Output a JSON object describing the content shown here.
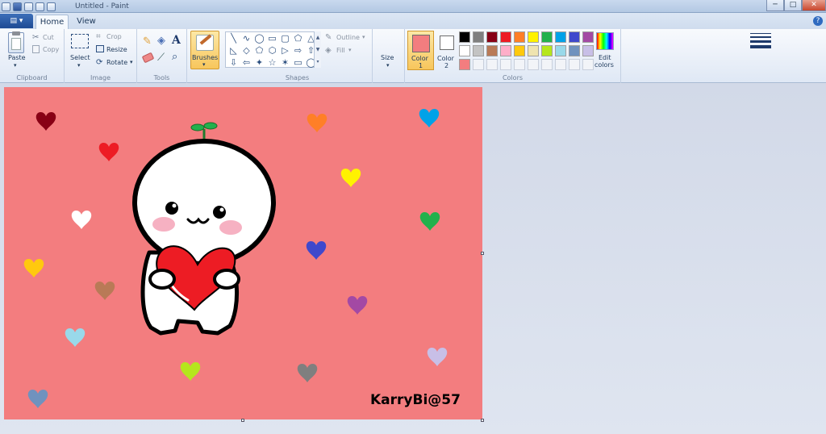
{
  "window": {
    "title": "Untitled - Paint",
    "minimize": "─",
    "maximize": "□",
    "close": "✕"
  },
  "tabs": {
    "app_button": "▤ ▾",
    "home": "Home",
    "view": "View",
    "help": "?"
  },
  "clipboard": {
    "paste": "Paste",
    "cut": "Cut",
    "copy": "Copy",
    "group": "Clipboard"
  },
  "image": {
    "select": "Select",
    "crop": "Crop",
    "resize": "Resize",
    "rotate": "Rotate",
    "group": "Image"
  },
  "tools": {
    "group": "Tools"
  },
  "brushes": {
    "label": "Brushes"
  },
  "shapes": {
    "group": "Shapes",
    "outline": "Outline",
    "fill": "Fill",
    "items": [
      "╲",
      "∿",
      "◯",
      "▭",
      "▢",
      "⬠",
      "△",
      "◺",
      "◇",
      "⬠",
      "⬡",
      "▷",
      "⇨",
      "⇧",
      "⇩",
      "⇦",
      "✦",
      "☆",
      "✶",
      "▭",
      "◯"
    ]
  },
  "size": {
    "label": "Size"
  },
  "colors": {
    "group": "Colors",
    "color1_label": "Color",
    "color1_num": "1",
    "color2_label": "Color",
    "color2_num": "2",
    "edit_label": "Edit",
    "edit_label2": "colors",
    "color1_value": "#f37d7f",
    "color2_value": "#ffffff",
    "palette_row1": [
      "#000000",
      "#7f7f7f",
      "#880015",
      "#ed1c24",
      "#ff7f27",
      "#fff200",
      "#22b14c",
      "#00a2e8",
      "#3f48cc",
      "#a349a4"
    ],
    "palette_row2": [
      "#ffffff",
      "#c3c3c3",
      "#b97a57",
      "#ffaec9",
      "#ffc90e",
      "#efe4b0",
      "#b5e61d",
      "#99d9ea",
      "#7092be",
      "#c8bfe7"
    ],
    "palette_row3": [
      "#f37d7f",
      "",
      "",
      "",
      "",
      "",
      "",
      "",
      "",
      ""
    ]
  },
  "canvas": {
    "background": "#f37d7f",
    "signature": "KarryBi@57",
    "hearts": [
      {
        "name": "heart-darkred",
        "color": "#880015"
      },
      {
        "name": "heart-red",
        "color": "#ed1c24"
      },
      {
        "name": "heart-white",
        "color": "#ffffff"
      },
      {
        "name": "heart-yellow-left",
        "color": "#ffc90e"
      },
      {
        "name": "heart-brown",
        "color": "#b97a57"
      },
      {
        "name": "heart-lightblue",
        "color": "#99d9ea"
      },
      {
        "name": "heart-steelblue",
        "color": "#7092be"
      },
      {
        "name": "heart-lime",
        "color": "#b5e61d"
      },
      {
        "name": "heart-gray",
        "color": "#7f7f7f"
      },
      {
        "name": "heart-lavender",
        "color": "#c8bfe7"
      },
      {
        "name": "heart-purple",
        "color": "#a349a4"
      },
      {
        "name": "heart-indigo",
        "color": "#3f48cc"
      },
      {
        "name": "heart-green",
        "color": "#22b14c"
      },
      {
        "name": "heart-yellow",
        "color": "#fff200"
      },
      {
        "name": "heart-orange",
        "color": "#ff7f27"
      },
      {
        "name": "heart-blue",
        "color": "#00a2e8"
      }
    ]
  }
}
